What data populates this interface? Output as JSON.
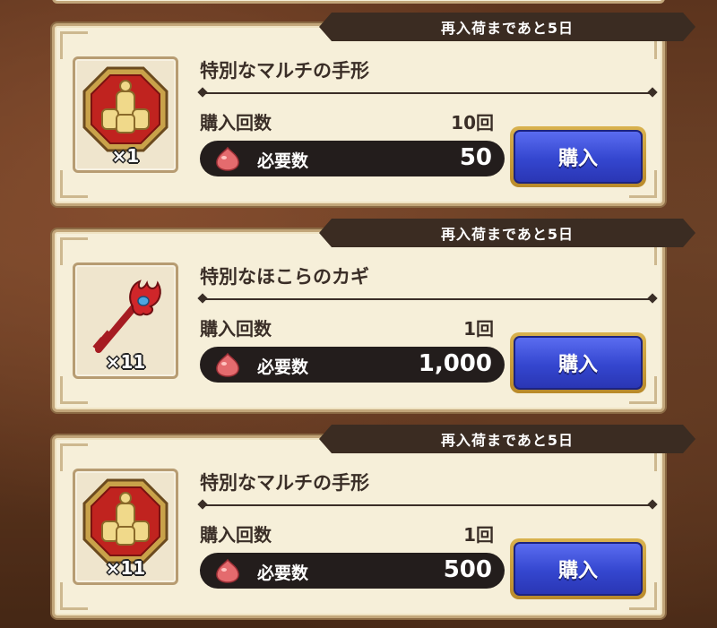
{
  "cards": [
    {
      "tab": "再入荷まであと5日",
      "name": "特別なマルチの手形",
      "qty": "×1",
      "count_label": "購入回数",
      "count_value": "10回",
      "cost_label": "必要数",
      "cost_value": "50",
      "buy_label": "購入",
      "icon": "multi-ticket-icon"
    },
    {
      "tab": "再入荷まであと5日",
      "name": "特別なほこらのカギ",
      "qty": "×11",
      "count_label": "購入回数",
      "count_value": "1回",
      "cost_label": "必要数",
      "cost_value": "1,000",
      "buy_label": "購入",
      "icon": "shrine-key-icon"
    },
    {
      "tab": "再入荷まであと5日",
      "name": "特別なマルチの手形",
      "qty": "×11",
      "count_label": "購入回数",
      "count_value": "1回",
      "cost_label": "必要数",
      "cost_value": "500",
      "buy_label": "購入",
      "icon": "multi-ticket-icon"
    }
  ],
  "colors": {
    "panel": "#f6efd9",
    "tab": "#3b2c22",
    "button": "#3446cf",
    "cost_bar": "#231d1c"
  }
}
